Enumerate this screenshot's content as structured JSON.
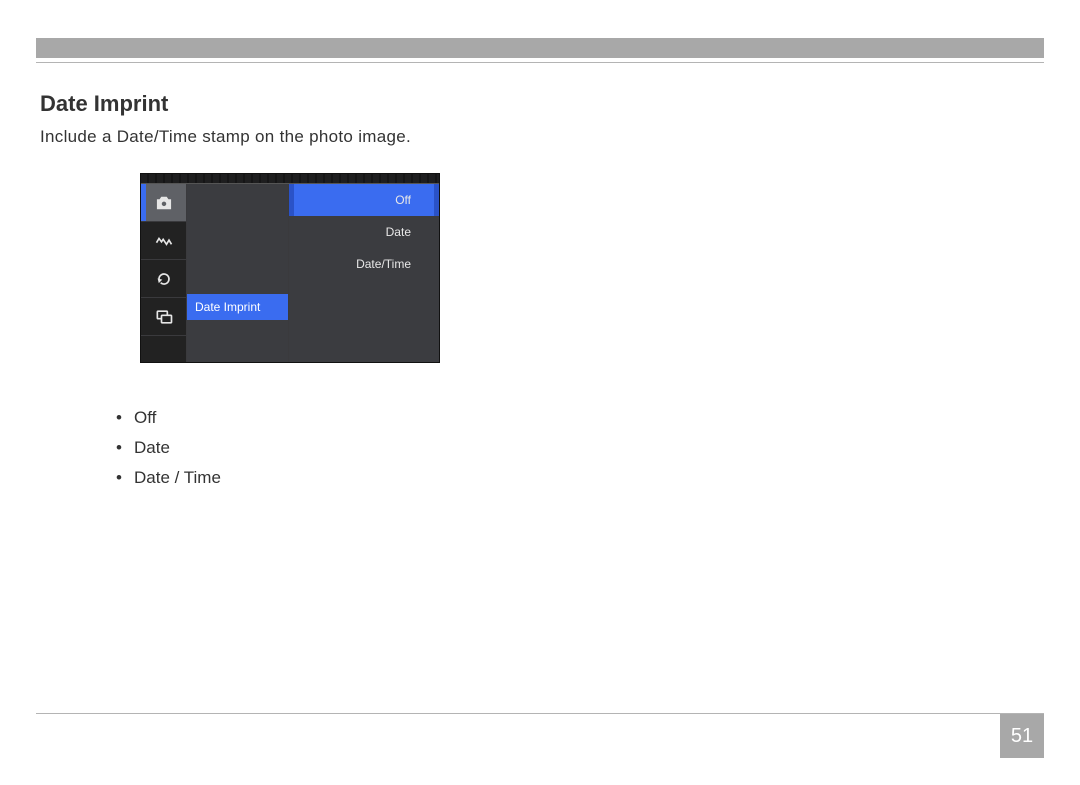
{
  "heading": "Date Imprint",
  "caption": "Include a Date/Time stamp on the photo image.",
  "menu": {
    "selected_row": "Date Imprint",
    "options": [
      "Off",
      "Date",
      "Date/Time"
    ]
  },
  "option_bullets": [
    "Off",
    "Date",
    "Date / Time"
  ],
  "page_number": "51",
  "tab_icons": [
    "camera-icon",
    "burst-icon",
    "refresh-icon",
    "screens-icon"
  ]
}
